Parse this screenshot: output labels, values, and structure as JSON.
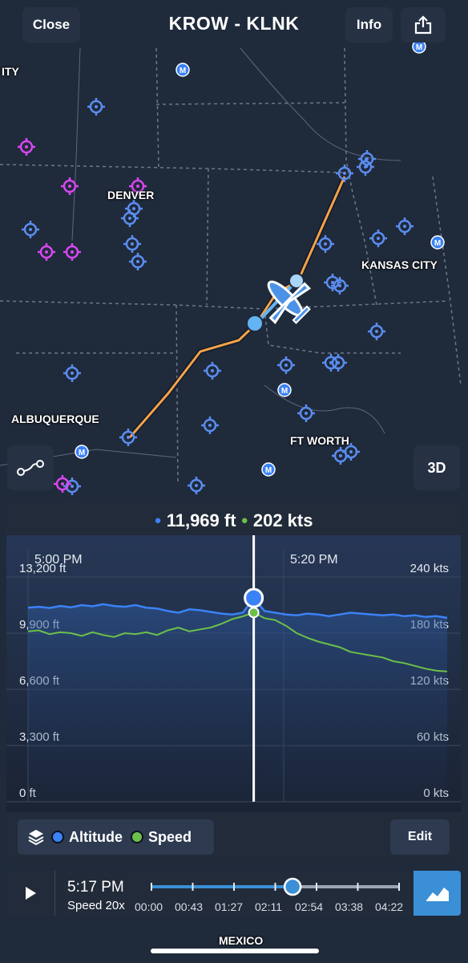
{
  "header": {
    "close_label": "Close",
    "title": "KROW - KLNK",
    "info_label": "Info"
  },
  "map": {
    "labels": [
      "ITY",
      "DENVER",
      "KANSAS CITY",
      "ALBUQUERQUE",
      "FT WORTH",
      "MEXICO"
    ],
    "mode_button": "3D"
  },
  "readout": {
    "altitude": "11,969 ft",
    "speed": "202 kts"
  },
  "chart_data": {
    "type": "line",
    "time_labels": [
      "5:00 PM",
      "5:20 PM"
    ],
    "left_axis": {
      "ticks": [
        "13,200 ft",
        "9,900 ft",
        "6,600 ft",
        "3,300 ft",
        "0 ft"
      ],
      "range": [
        0,
        13200
      ]
    },
    "right_axis": {
      "ticks": [
        "240 kts",
        "180 kts",
        "120 kts",
        "60 kts",
        "0 kts"
      ],
      "range": [
        0,
        240
      ]
    },
    "series": [
      {
        "name": "Altitude",
        "unit": "ft",
        "color": "#3b82f6",
        "values": [
          11400,
          11450,
          11380,
          11500,
          11420,
          11550,
          11480,
          11600,
          11500,
          11450,
          11550,
          11400,
          11350,
          11200,
          11100,
          11300,
          11250,
          11150,
          11050,
          11000,
          11100,
          11969,
          11200,
          11100,
          11000,
          10950,
          11050,
          11000,
          10900,
          11000,
          11100,
          11050,
          11000,
          10950,
          11000,
          10900,
          10950,
          10850,
          10900,
          10800
        ]
      },
      {
        "name": "Speed",
        "unit": "kts",
        "color": "#6cc04a",
        "values": [
          182,
          183,
          179,
          181,
          180,
          177,
          181,
          178,
          176,
          180,
          179,
          181,
          178,
          183,
          186,
          182,
          184,
          186,
          190,
          195,
          198,
          202,
          196,
          194,
          188,
          180,
          175,
          171,
          168,
          165,
          160,
          158,
          156,
          154,
          150,
          148,
          145,
          142,
          140,
          139
        ]
      }
    ],
    "cursor_index": 21
  },
  "legend": {
    "altitude_label": "Altitude",
    "speed_label": "Speed",
    "edit_label": "Edit"
  },
  "playback": {
    "time": "5:17 PM",
    "speed": "Speed 20x",
    "ticks": [
      "00:00",
      "00:43",
      "01:27",
      "02:11",
      "02:54",
      "03:38",
      "04:22"
    ],
    "progress": 0.57
  },
  "colors": {
    "accent": "#3b8fd6",
    "route": "#f2a24a",
    "altitude": "#3b82f6",
    "speed": "#6cc04a"
  }
}
